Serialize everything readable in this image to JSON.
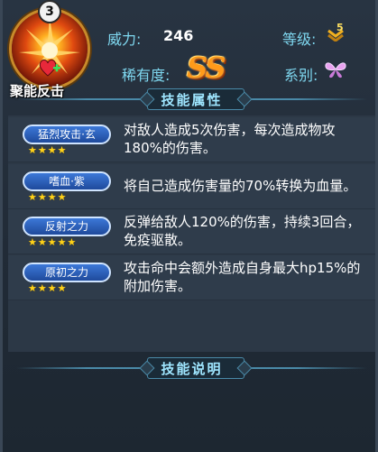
{
  "skill": {
    "name": "聚能反击",
    "level_badge": "3",
    "icon": "flame-burst-icon",
    "sub_icon": "heart-plus-icon"
  },
  "stats": {
    "power_label": "威力:",
    "power_value": "246",
    "grade_label": "等级:",
    "grade_value": "5",
    "grade_icon": "chevron-rank-icon",
    "rarity_label": "稀有度:",
    "rarity_value": "SS",
    "type_label": "系别:",
    "type_icon": "butterfly-icon"
  },
  "sections": {
    "attributes_title": "技能属性",
    "description_title": "技能说明"
  },
  "traits": [
    {
      "name": "猛烈攻击·玄",
      "stars": 4,
      "desc": "对敌人造成5次伤害，每次造成物攻180%的伤害。"
    },
    {
      "name": "嗜血·紫",
      "stars": 4,
      "desc": "将自己造成伤害量的70%转换为血量。"
    },
    {
      "name": "反射之力",
      "stars": 5,
      "desc": "反弹给敌人120%的伤害，持续3回合，免疫驱散。"
    },
    {
      "name": "原初之力",
      "stars": 4,
      "desc": "攻击命中会额外造成自身最大hp15%的附加伤害。"
    }
  ],
  "colors": {
    "label": "#7fd8f0",
    "rarity": "#ff9a1a",
    "star": "#ffd21a",
    "pill": "#2f5fb8"
  }
}
